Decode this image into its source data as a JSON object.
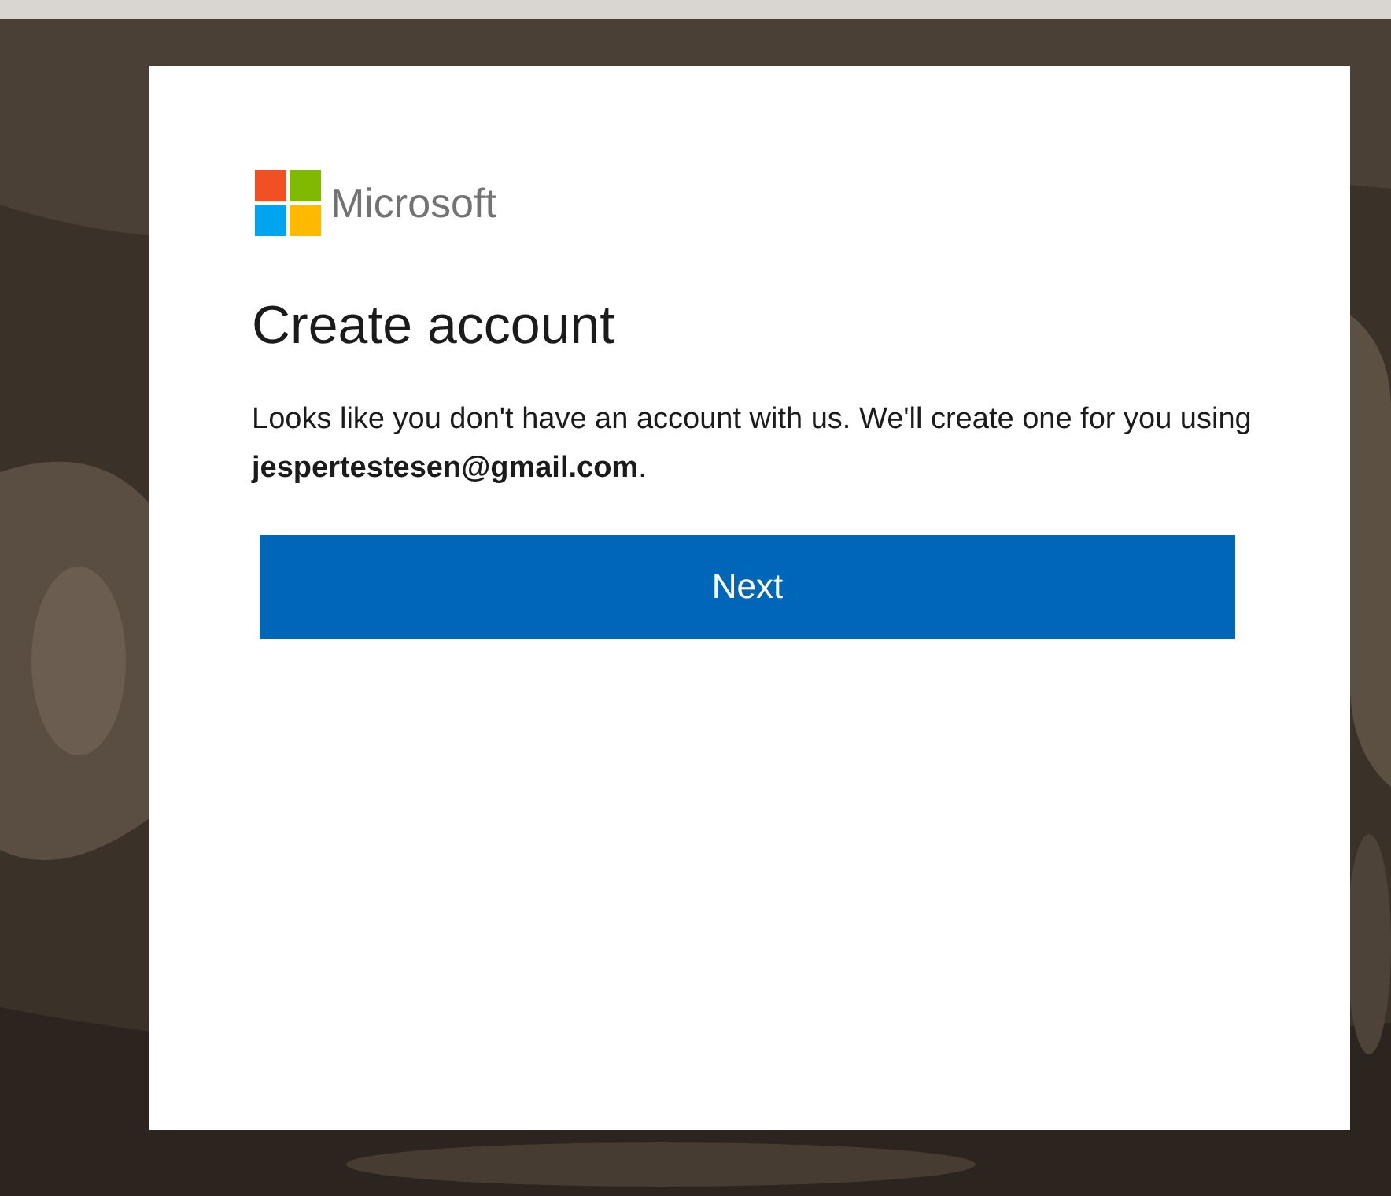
{
  "brand": {
    "name": "Microsoft"
  },
  "title": "Create account",
  "message": "Looks like you don't have an account with us. We'll create one for you using",
  "email_line": "**jespertestesen@gmail.com**.",
  "button": {
    "label": "Next"
  }
}
